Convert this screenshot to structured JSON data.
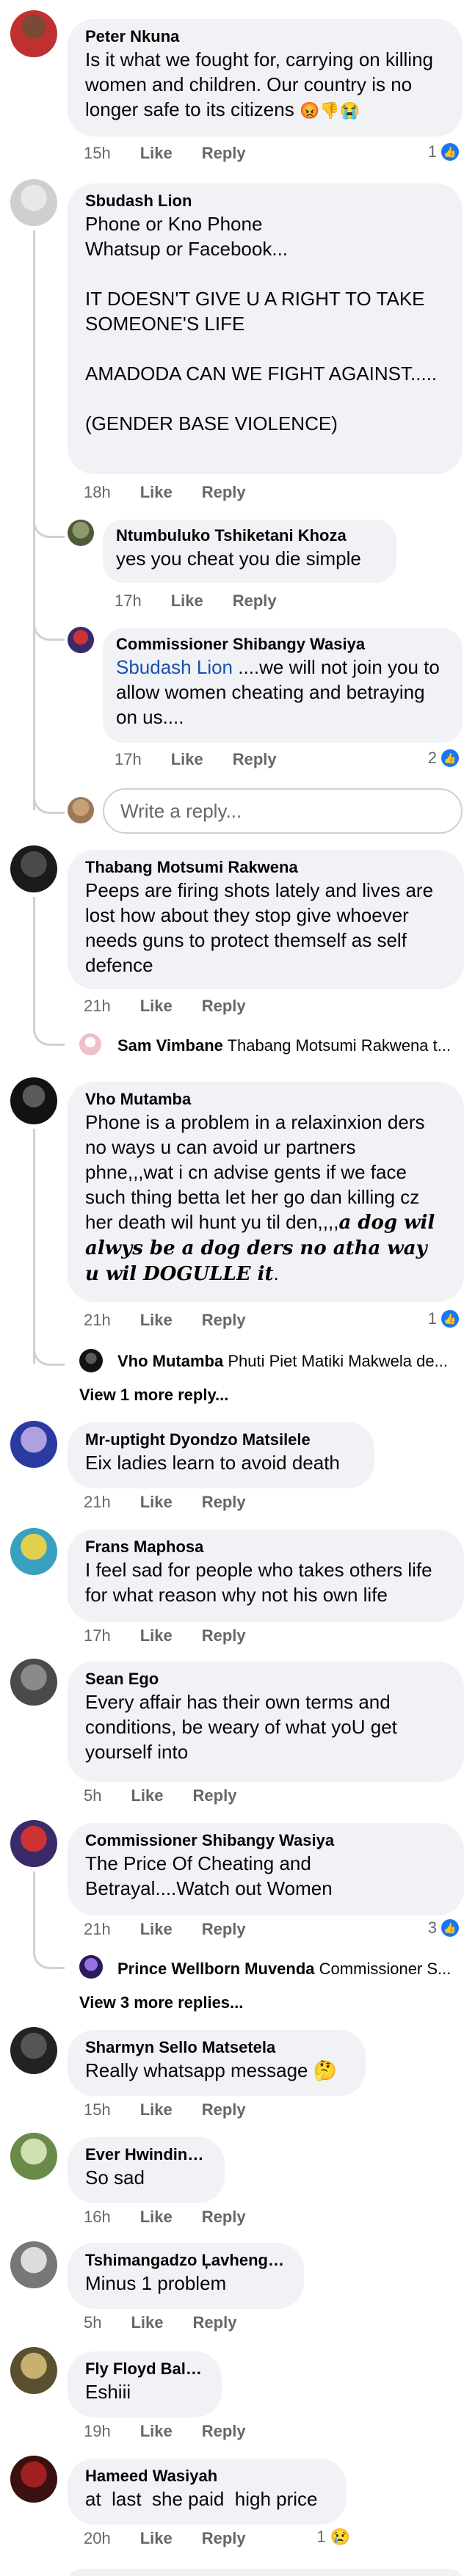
{
  "comments": [
    {
      "author": "Peter Nkuna",
      "text": "Is it what we fought for, carrying on killing women and children. Our country is no longer safe to its citizens",
      "emoji": "😡👎😭",
      "time": "15h",
      "reactions": "1"
    },
    {
      "author": "Sbudash Lion",
      "text": "Phone or Kno Phone\nWhatsup or Facebook...\n\nIT DOESN'T GIVE U A RIGHT TO TAKE SOMEONE'S LIFE\n\nAMADODA CAN WE FIGHT AGAINST.....\n\n(GENDER BASE VIOLENCE)",
      "time": "18h"
    },
    {
      "author": "Ntumbuluko Tshiketani Khoza",
      "text": "yes you cheat you die simple",
      "time": "17h"
    },
    {
      "author": "Commissioner Shibangy Wasiya",
      "mention": "Sbudash Lion",
      "text": " ....we will not join you to allow women cheating and betraying on us....",
      "time": "17h",
      "reactions": "2"
    },
    {
      "author": "Thabang Motsumi Rakwena",
      "text": "Peeps are firing shots lately and lives are lost how about they stop give whoever needs guns to protect themself as self defence",
      "time": "21h"
    },
    {
      "author": "Vho Mutamba",
      "text": "Phone is a problem in a relaxinxion ders no ways u can avoid ur partners phne,,,wat i cn advise gents if we face such thing betta let her go dan killing cz her death wil hunt yu til den,,,,",
      "styled": "a dog wil alwys be a dog ders no atha way u wil DOGULLE it",
      "end": ".",
      "time": "21h",
      "reactions": "1"
    },
    {
      "author": "Mr-uptight Dyondzo Matsilele",
      "text": "Eix ladies learn to avoid death",
      "time": "21h"
    },
    {
      "author": "Frans Maphosa",
      "text": "I feel sad for people who takes others life for what reason why not his own life",
      "time": "17h"
    },
    {
      "author": "Sean Ego",
      "text": "Every affair has their own terms and conditions, be weary of what yoU get yourself into",
      "time": "5h"
    },
    {
      "author": "Commissioner Shibangy Wasiya",
      "text": "The Price Of Cheating and Betrayal....Watch out Women",
      "time": "21h",
      "reactions": "3"
    },
    {
      "author": "Sharmyn Sello Matsetela",
      "text": "Really whatsapp message",
      "emoji": "🤔",
      "time": "15h"
    },
    {
      "author": "Ever Hwindingwi",
      "text": "So sad",
      "time": "16h"
    },
    {
      "author": "Tshimangadzo Ļavhengwa",
      "text": "Minus 1 problem",
      "time": "5h"
    },
    {
      "author": "Fly Floyd Baloyi",
      "text": "Eshiii",
      "time": "19h"
    },
    {
      "author": "Hameed Wasiyah",
      "text": "at  last  she paid  high price",
      "time": "20h",
      "reactions": "1",
      "reaction_emoji": "😢"
    }
  ],
  "collapsed": [
    {
      "author": "Sam Vimbane",
      "snippet": "Thabang Motsumi Rakwena t..."
    },
    {
      "author": "Vho Mutamba",
      "snippet": "Phuti Piet Matiki Makwela de..."
    },
    {
      "author": "Prince Wellborn Muvenda",
      "snippet": "Commissioner S..."
    }
  ],
  "labels": {
    "like": "Like",
    "reply": "Reply",
    "write_reply": "Write a reply...",
    "view_1_more": "View 1 more reply...",
    "view_3_more": "View 3 more replies..."
  },
  "colors": {
    "bubble": "#f0f2f5",
    "like_blue": "#1877f2",
    "mention_blue": "#1b4fb0",
    "meta_gray": "#65676b"
  }
}
